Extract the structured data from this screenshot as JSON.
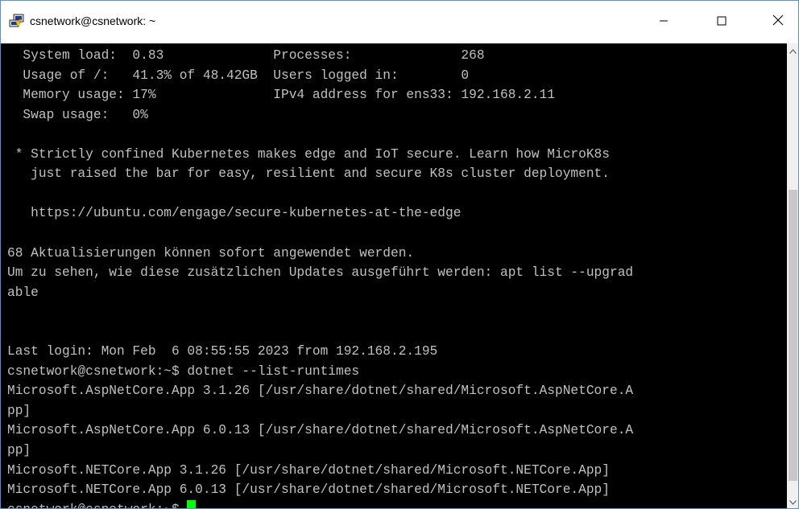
{
  "window": {
    "title": "csnetwork@csnetwork: ~"
  },
  "icons": {
    "app": "putty-icon",
    "minimize": "minimize-icon",
    "maximize": "maximize-icon",
    "close": "close-icon",
    "scroll_up": "chevron-up-icon",
    "scroll_down": "chevron-down-icon"
  },
  "colors": {
    "terminal_background": "#000000",
    "terminal_text": "#c0c0c0",
    "cursor": "#00ff00"
  },
  "terminal": {
    "lines": [
      "  System load:  0.83              Processes:              268",
      "  Usage of /:   41.3% of 48.42GB  Users logged in:        0",
      "  Memory usage: 17%               IPv4 address for ens33: 192.168.2.11",
      "  Swap usage:   0%",
      "",
      " * Strictly confined Kubernetes makes edge and IoT secure. Learn how MicroK8s",
      "   just raised the bar for easy, resilient and secure K8s cluster deployment.",
      "",
      "   https://ubuntu.com/engage/secure-kubernetes-at-the-edge",
      "",
      "68 Aktualisierungen können sofort angewendet werden.",
      "Um zu sehen, wie diese zusätzlichen Updates ausgeführt werden: apt list --upgrad",
      "able",
      "",
      "",
      "Last login: Mon Feb  6 08:55:55 2023 from 192.168.2.195",
      "csnetwork@csnetwork:~$ dotnet --list-runtimes",
      "Microsoft.AspNetCore.App 3.1.26 [/usr/share/dotnet/shared/Microsoft.AspNetCore.A",
      "pp]",
      "Microsoft.AspNetCore.App 6.0.13 [/usr/share/dotnet/shared/Microsoft.AspNetCore.A",
      "pp]",
      "Microsoft.NETCore.App 3.1.26 [/usr/share/dotnet/shared/Microsoft.NETCore.App]",
      "Microsoft.NETCore.App 6.0.13 [/usr/share/dotnet/shared/Microsoft.NETCore.App]"
    ],
    "prompt": "csnetwork@csnetwork:~$ "
  }
}
